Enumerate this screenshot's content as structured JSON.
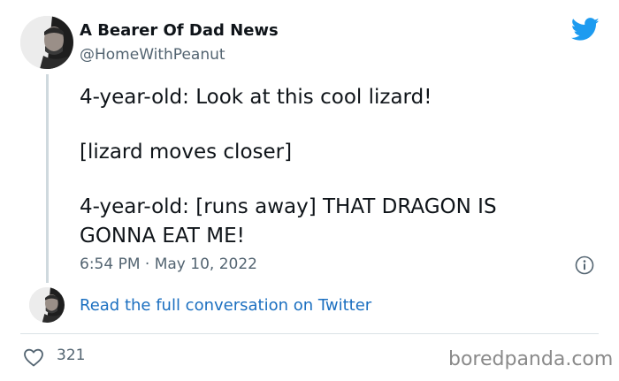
{
  "author": {
    "name": "A Bearer Of Dad News",
    "handle": "@HomeWithPeanut"
  },
  "tweet": {
    "lines": [
      "4-year-old: Look at this cool lizard!",
      "[lizard moves closer]",
      "4-year-old: [runs away] THAT DRAGON IS",
      "GONNA EAT ME!"
    ],
    "timestamp": "6:54 PM · May 10, 2022"
  },
  "actions": {
    "read_full_label": "Read the full conversation on Twitter",
    "like_count": "321"
  },
  "watermark": "boredpanda.com",
  "icons": {
    "brand": "twitter-bird-icon",
    "info": "info-icon",
    "like": "heart-icon"
  },
  "colors": {
    "twitter_blue": "#1d9bf0",
    "link_blue": "#1b6fc0",
    "secondary_text": "#536471"
  }
}
